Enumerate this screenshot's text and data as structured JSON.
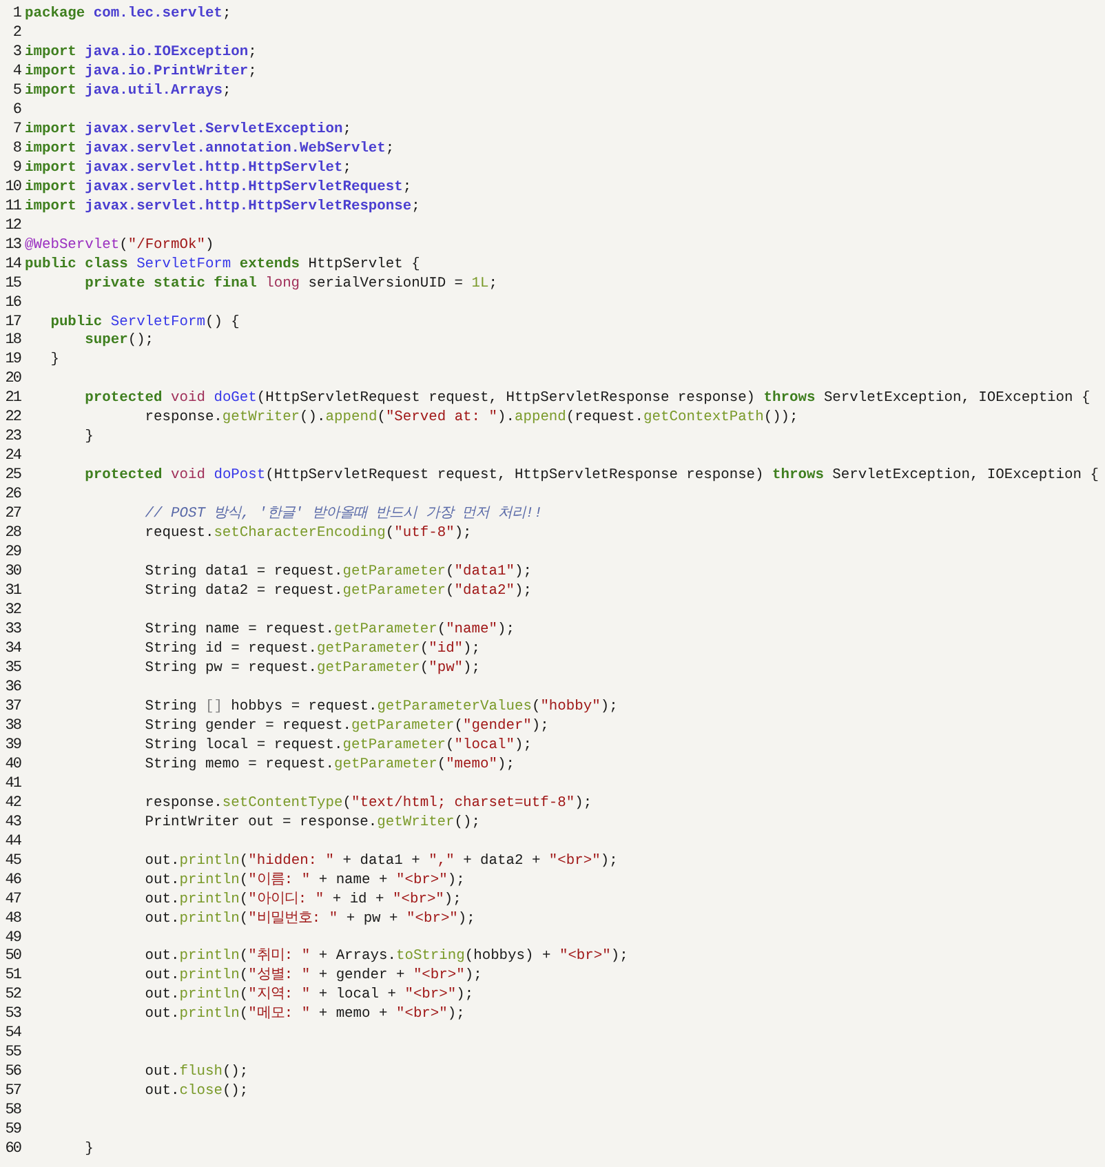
{
  "editor": {
    "lines": [
      {
        "number": "1",
        "tokens": [
          {
            "kind": "keyword",
            "text": "package"
          },
          {
            "kind": "package",
            "text": " com.lec.servlet"
          },
          {
            "kind": "plain",
            "text": ";"
          }
        ]
      },
      {
        "number": "2"
      },
      {
        "number": "3",
        "tokens": [
          {
            "kind": "keyword",
            "text": "import"
          },
          {
            "kind": "package",
            "text": " java.io.IOException"
          },
          {
            "kind": "plain",
            "text": ";"
          }
        ]
      },
      {
        "number": "4",
        "tokens": [
          {
            "kind": "keyword",
            "text": "import"
          },
          {
            "kind": "package",
            "text": " java.io.PrintWriter"
          },
          {
            "kind": "plain",
            "text": ";"
          }
        ]
      },
      {
        "number": "5",
        "tokens": [
          {
            "kind": "keyword",
            "text": "import"
          },
          {
            "kind": "package",
            "text": " java.util.Arrays"
          },
          {
            "kind": "plain",
            "text": ";"
          }
        ]
      },
      {
        "number": "6"
      },
      {
        "number": "7",
        "tokens": [
          {
            "kind": "keyword",
            "text": "import"
          },
          {
            "kind": "package",
            "text": " javax.servlet.ServletException"
          },
          {
            "kind": "plain",
            "text": ";"
          }
        ]
      },
      {
        "number": "8",
        "tokens": [
          {
            "kind": "keyword",
            "text": "import"
          },
          {
            "kind": "package",
            "text": " javax.servlet.annotation.WebServlet"
          },
          {
            "kind": "plain",
            "text": ";"
          }
        ]
      },
      {
        "number": "9",
        "tokens": [
          {
            "kind": "keyword",
            "text": "import"
          },
          {
            "kind": "package",
            "text": " javax.servlet.http.HttpServlet"
          },
          {
            "kind": "plain",
            "text": ";"
          }
        ]
      },
      {
        "number": "10",
        "tokens": [
          {
            "kind": "keyword",
            "text": "import"
          },
          {
            "kind": "package",
            "text": " javax.servlet.http.HttpServletRequest"
          },
          {
            "kind": "plain",
            "text": ";"
          }
        ]
      },
      {
        "number": "11",
        "tokens": [
          {
            "kind": "keyword",
            "text": "import"
          },
          {
            "kind": "package",
            "text": " javax.servlet.http.HttpServletResponse"
          },
          {
            "kind": "plain",
            "text": ";"
          }
        ]
      },
      {
        "number": "12"
      },
      {
        "number": "13",
        "tokens": [
          {
            "kind": "annotation",
            "text": "@WebServlet"
          },
          {
            "kind": "plain",
            "text": "("
          },
          {
            "kind": "string",
            "text": "\"/FormOk\""
          },
          {
            "kind": "plain",
            "text": ")"
          }
        ]
      },
      {
        "number": "14",
        "tokens": [
          {
            "kind": "keyword",
            "text": "public class"
          },
          {
            "kind": "name",
            "text": " ServletForm"
          },
          {
            "kind": "keyword",
            "text": " extends"
          },
          {
            "kind": "plain",
            "text": " HttpServlet {"
          }
        ]
      },
      {
        "number": "15",
        "tokens": [
          {
            "kind": "keyword",
            "text": "       private static final"
          },
          {
            "kind": "type",
            "text": " long"
          },
          {
            "kind": "plain",
            "text": " serialVersionUID = "
          },
          {
            "kind": "number",
            "text": "1L"
          },
          {
            "kind": "plain",
            "text": ";"
          }
        ]
      },
      {
        "number": "16"
      },
      {
        "number": "17",
        "tokens": [
          {
            "kind": "keyword",
            "text": "   public"
          },
          {
            "kind": "name",
            "text": " ServletForm"
          },
          {
            "kind": "plain",
            "text": "() {"
          }
        ]
      },
      {
        "number": "18",
        "tokens": [
          {
            "kind": "keyword",
            "text": "       super"
          },
          {
            "kind": "plain",
            "text": "();"
          }
        ]
      },
      {
        "number": "19",
        "tokens": [
          {
            "kind": "plain",
            "text": "   }"
          }
        ]
      },
      {
        "number": "20"
      },
      {
        "number": "21",
        "tokens": [
          {
            "kind": "keyword",
            "text": "       protected"
          },
          {
            "kind": "type",
            "text": " void"
          },
          {
            "kind": "name",
            "text": " doGet"
          },
          {
            "kind": "plain",
            "text": "(HttpServletRequest request, HttpServletResponse response) "
          },
          {
            "kind": "keyword",
            "text": "throws"
          },
          {
            "kind": "plain",
            "text": " ServletException, IOException {"
          }
        ]
      },
      {
        "number": "22",
        "tokens": [
          {
            "kind": "plain",
            "text": "              response."
          },
          {
            "kind": "method",
            "text": "getWriter"
          },
          {
            "kind": "plain",
            "text": "()."
          },
          {
            "kind": "method",
            "text": "append"
          },
          {
            "kind": "plain",
            "text": "("
          },
          {
            "kind": "string",
            "text": "\"Served at: \""
          },
          {
            "kind": "plain",
            "text": ")."
          },
          {
            "kind": "method",
            "text": "append"
          },
          {
            "kind": "plain",
            "text": "(request."
          },
          {
            "kind": "method",
            "text": "getContextPath"
          },
          {
            "kind": "plain",
            "text": "());"
          }
        ]
      },
      {
        "number": "23",
        "tokens": [
          {
            "kind": "plain",
            "text": "       }"
          }
        ]
      },
      {
        "number": "24"
      },
      {
        "number": "25",
        "tokens": [
          {
            "kind": "keyword",
            "text": "       protected"
          },
          {
            "kind": "type",
            "text": " void"
          },
          {
            "kind": "name",
            "text": " doPost"
          },
          {
            "kind": "plain",
            "text": "(HttpServletRequest request, HttpServletResponse response) "
          },
          {
            "kind": "keyword",
            "text": "throws"
          },
          {
            "kind": "plain",
            "text": " ServletException, IOException {"
          }
        ]
      },
      {
        "number": "26"
      },
      {
        "number": "27",
        "tokens": [
          {
            "kind": "comment",
            "text": "              // POST 방식, '한글' 받아올때 반드시 가장 먼저 처리!!"
          }
        ]
      },
      {
        "number": "28",
        "tokens": [
          {
            "kind": "plain",
            "text": "              request."
          },
          {
            "kind": "method",
            "text": "setCharacterEncoding"
          },
          {
            "kind": "plain",
            "text": "("
          },
          {
            "kind": "string",
            "text": "\"utf-8\""
          },
          {
            "kind": "plain",
            "text": ");"
          }
        ]
      },
      {
        "number": "29"
      },
      {
        "number": "30",
        "tokens": [
          {
            "kind": "plain",
            "text": "              String data1 = request."
          },
          {
            "kind": "method",
            "text": "getParameter"
          },
          {
            "kind": "plain",
            "text": "("
          },
          {
            "kind": "string",
            "text": "\"data1\""
          },
          {
            "kind": "plain",
            "text": ");"
          }
        ]
      },
      {
        "number": "31",
        "tokens": [
          {
            "kind": "plain",
            "text": "              String data2 = request."
          },
          {
            "kind": "method",
            "text": "getParameter"
          },
          {
            "kind": "plain",
            "text": "("
          },
          {
            "kind": "string",
            "text": "\"data2\""
          },
          {
            "kind": "plain",
            "text": ");"
          }
        ]
      },
      {
        "number": "32"
      },
      {
        "number": "33",
        "tokens": [
          {
            "kind": "plain",
            "text": "              String name = request."
          },
          {
            "kind": "method",
            "text": "getParameter"
          },
          {
            "kind": "plain",
            "text": "("
          },
          {
            "kind": "string",
            "text": "\"name\""
          },
          {
            "kind": "plain",
            "text": ");"
          }
        ]
      },
      {
        "number": "34",
        "tokens": [
          {
            "kind": "plain",
            "text": "              String id = request."
          },
          {
            "kind": "method",
            "text": "getParameter"
          },
          {
            "kind": "plain",
            "text": "("
          },
          {
            "kind": "string",
            "text": "\"id\""
          },
          {
            "kind": "plain",
            "text": ");"
          }
        ]
      },
      {
        "number": "35",
        "tokens": [
          {
            "kind": "plain",
            "text": "              String pw = request."
          },
          {
            "kind": "method",
            "text": "getParameter"
          },
          {
            "kind": "plain",
            "text": "("
          },
          {
            "kind": "string",
            "text": "\"pw\""
          },
          {
            "kind": "plain",
            "text": ");"
          }
        ]
      },
      {
        "number": "36"
      },
      {
        "number": "37",
        "tokens": [
          {
            "kind": "plain",
            "text": "              String "
          },
          {
            "kind": "punct",
            "text": "[]"
          },
          {
            "kind": "plain",
            "text": " hobbys = request."
          },
          {
            "kind": "method",
            "text": "getParameterValues"
          },
          {
            "kind": "plain",
            "text": "("
          },
          {
            "kind": "string",
            "text": "\"hobby\""
          },
          {
            "kind": "plain",
            "text": ");"
          }
        ]
      },
      {
        "number": "38",
        "tokens": [
          {
            "kind": "plain",
            "text": "              String gender = request."
          },
          {
            "kind": "method",
            "text": "getParameter"
          },
          {
            "kind": "plain",
            "text": "("
          },
          {
            "kind": "string",
            "text": "\"gender\""
          },
          {
            "kind": "plain",
            "text": ");"
          }
        ]
      },
      {
        "number": "39",
        "tokens": [
          {
            "kind": "plain",
            "text": "              String local = request."
          },
          {
            "kind": "method",
            "text": "getParameter"
          },
          {
            "kind": "plain",
            "text": "("
          },
          {
            "kind": "string",
            "text": "\"local\""
          },
          {
            "kind": "plain",
            "text": ");"
          }
        ]
      },
      {
        "number": "40",
        "tokens": [
          {
            "kind": "plain",
            "text": "              String memo = request."
          },
          {
            "kind": "method",
            "text": "getParameter"
          },
          {
            "kind": "plain",
            "text": "("
          },
          {
            "kind": "string",
            "text": "\"memo\""
          },
          {
            "kind": "plain",
            "text": ");"
          }
        ]
      },
      {
        "number": "41"
      },
      {
        "number": "42",
        "tokens": [
          {
            "kind": "plain",
            "text": "              response."
          },
          {
            "kind": "method",
            "text": "setContentType"
          },
          {
            "kind": "plain",
            "text": "("
          },
          {
            "kind": "string",
            "text": "\"text/html; charset=utf-8\""
          },
          {
            "kind": "plain",
            "text": ");"
          }
        ]
      },
      {
        "number": "43",
        "tokens": [
          {
            "kind": "plain",
            "text": "              PrintWriter out = response."
          },
          {
            "kind": "method",
            "text": "getWriter"
          },
          {
            "kind": "plain",
            "text": "();"
          }
        ]
      },
      {
        "number": "44"
      },
      {
        "number": "45",
        "tokens": [
          {
            "kind": "plain",
            "text": "              out."
          },
          {
            "kind": "method",
            "text": "println"
          },
          {
            "kind": "plain",
            "text": "("
          },
          {
            "kind": "string",
            "text": "\"hidden: \""
          },
          {
            "kind": "plain",
            "text": " + data1 + "
          },
          {
            "kind": "string",
            "text": "\",\""
          },
          {
            "kind": "plain",
            "text": " + data2 + "
          },
          {
            "kind": "string",
            "text": "\"<br>\""
          },
          {
            "kind": "plain",
            "text": ");"
          }
        ]
      },
      {
        "number": "46",
        "tokens": [
          {
            "kind": "plain",
            "text": "              out."
          },
          {
            "kind": "method",
            "text": "println"
          },
          {
            "kind": "plain",
            "text": "("
          },
          {
            "kind": "string",
            "text": "\"이름: \""
          },
          {
            "kind": "plain",
            "text": " + name + "
          },
          {
            "kind": "string",
            "text": "\"<br>\""
          },
          {
            "kind": "plain",
            "text": ");"
          }
        ]
      },
      {
        "number": "47",
        "tokens": [
          {
            "kind": "plain",
            "text": "              out."
          },
          {
            "kind": "method",
            "text": "println"
          },
          {
            "kind": "plain",
            "text": "("
          },
          {
            "kind": "string",
            "text": "\"아이디: \""
          },
          {
            "kind": "plain",
            "text": " + id + "
          },
          {
            "kind": "string",
            "text": "\"<br>\""
          },
          {
            "kind": "plain",
            "text": ");"
          }
        ]
      },
      {
        "number": "48",
        "tokens": [
          {
            "kind": "plain",
            "text": "              out."
          },
          {
            "kind": "method",
            "text": "println"
          },
          {
            "kind": "plain",
            "text": "("
          },
          {
            "kind": "string",
            "text": "\"비밀번호: \""
          },
          {
            "kind": "plain",
            "text": " + pw + "
          },
          {
            "kind": "string",
            "text": "\"<br>\""
          },
          {
            "kind": "plain",
            "text": ");"
          }
        ]
      },
      {
        "number": "49"
      },
      {
        "number": "50",
        "tokens": [
          {
            "kind": "plain",
            "text": "              out."
          },
          {
            "kind": "method",
            "text": "println"
          },
          {
            "kind": "plain",
            "text": "("
          },
          {
            "kind": "string",
            "text": "\"취미: \""
          },
          {
            "kind": "plain",
            "text": " + Arrays."
          },
          {
            "kind": "method",
            "text": "toString"
          },
          {
            "kind": "plain",
            "text": "(hobbys) + "
          },
          {
            "kind": "string",
            "text": "\"<br>\""
          },
          {
            "kind": "plain",
            "text": ");"
          }
        ]
      },
      {
        "number": "51",
        "tokens": [
          {
            "kind": "plain",
            "text": "              out."
          },
          {
            "kind": "method",
            "text": "println"
          },
          {
            "kind": "plain",
            "text": "("
          },
          {
            "kind": "string",
            "text": "\"성별: \""
          },
          {
            "kind": "plain",
            "text": " + gender + "
          },
          {
            "kind": "string",
            "text": "\"<br>\""
          },
          {
            "kind": "plain",
            "text": ");"
          }
        ]
      },
      {
        "number": "52",
        "tokens": [
          {
            "kind": "plain",
            "text": "              out."
          },
          {
            "kind": "method",
            "text": "println"
          },
          {
            "kind": "plain",
            "text": "("
          },
          {
            "kind": "string",
            "text": "\"지역: \""
          },
          {
            "kind": "plain",
            "text": " + local + "
          },
          {
            "kind": "string",
            "text": "\"<br>\""
          },
          {
            "kind": "plain",
            "text": ");"
          }
        ]
      },
      {
        "number": "53",
        "tokens": [
          {
            "kind": "plain",
            "text": "              out."
          },
          {
            "kind": "method",
            "text": "println"
          },
          {
            "kind": "plain",
            "text": "("
          },
          {
            "kind": "string",
            "text": "\"메모: \""
          },
          {
            "kind": "plain",
            "text": " + memo + "
          },
          {
            "kind": "string",
            "text": "\"<br>\""
          },
          {
            "kind": "plain",
            "text": ");"
          }
        ]
      },
      {
        "number": "54"
      },
      {
        "number": "55"
      },
      {
        "number": "56",
        "tokens": [
          {
            "kind": "plain",
            "text": "              out."
          },
          {
            "kind": "method",
            "text": "flush"
          },
          {
            "kind": "plain",
            "text": "();"
          }
        ]
      },
      {
        "number": "57",
        "tokens": [
          {
            "kind": "plain",
            "text": "              out."
          },
          {
            "kind": "method",
            "text": "close"
          },
          {
            "kind": "plain",
            "text": "();"
          }
        ]
      },
      {
        "number": "58"
      },
      {
        "number": "59"
      },
      {
        "number": "60",
        "tokens": [
          {
            "kind": "plain",
            "text": "       }"
          }
        ]
      }
    ]
  }
}
